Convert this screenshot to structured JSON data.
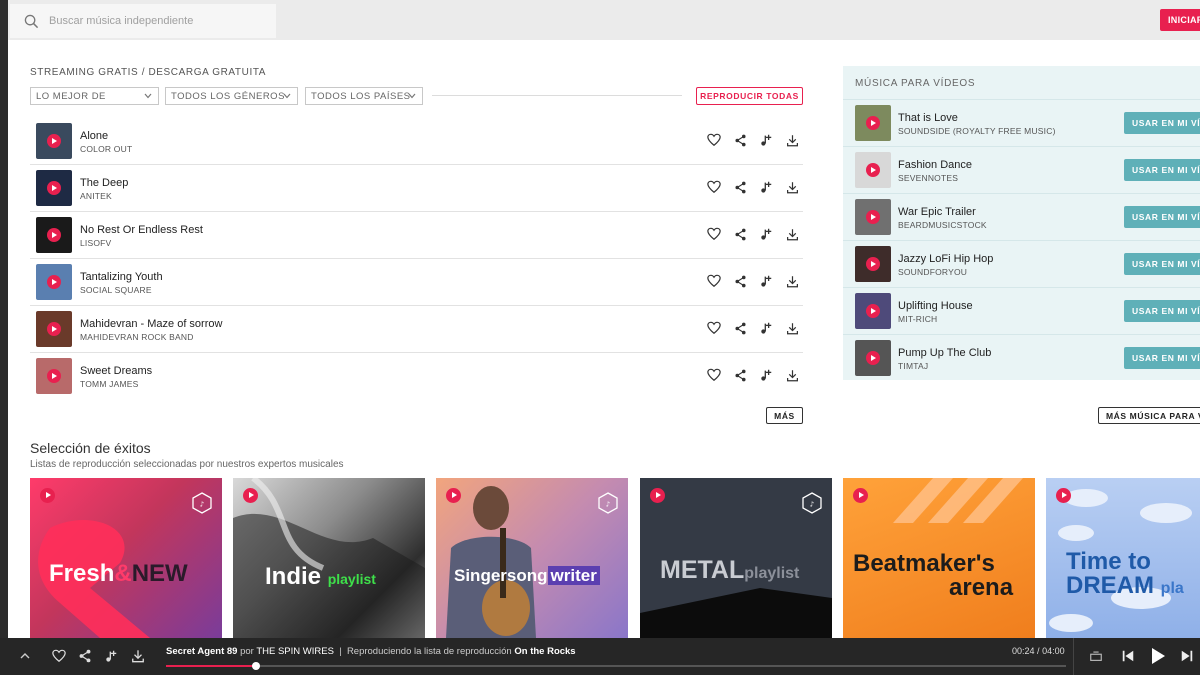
{
  "search": {
    "placeholder": "Buscar música independiente"
  },
  "header": {
    "login_label": "INICIAR"
  },
  "streaming": {
    "title": "STREAMING GRATIS / DESCARGA GRATUITA",
    "filters": [
      {
        "label": "LO MEJOR DE"
      },
      {
        "label": "TODOS LOS GÉNEROS"
      },
      {
        "label": "TODOS LOS PAÍSES"
      }
    ],
    "play_all_label": "REPRODUCIR TODAS",
    "more_label": "MÁS",
    "tracks": [
      {
        "title": "Alone",
        "artist": "COLOR OUT",
        "color": "#3a4a5e"
      },
      {
        "title": "The Deep",
        "artist": "ANITEK",
        "color": "#1e2a44"
      },
      {
        "title": "No Rest Or Endless Rest",
        "artist": "LISOFV",
        "color": "#1a1a1a"
      },
      {
        "title": "Tantalizing Youth",
        "artist": "SOCIAL SQUARE",
        "color": "#5a7fb0"
      },
      {
        "title": "Mahidevran - Maze of sorrow",
        "artist": "MAHIDEVRAN ROCK BAND",
        "color": "#6a3a2a"
      },
      {
        "title": "Sweet Dreams",
        "artist": "TOMM JAMES",
        "color": "#b86a6a"
      }
    ]
  },
  "music_for_videos": {
    "title": "MÚSICA PARA VÍDEOS",
    "use_label": "USAR EN MI VÍDEO",
    "more_label": "MÁS MÚSICA PARA VÍDEOS",
    "items": [
      {
        "title": "That is Love",
        "artist": "SOUNDSIDE (ROYALTY FREE MUSIC)",
        "color": "#7d8a5e"
      },
      {
        "title": "Fashion Dance",
        "artist": "SEVENNOTES",
        "color": "#d8d8d8"
      },
      {
        "title": "War Epic Trailer",
        "artist": "BEARDMUSICSTOCK",
        "color": "#707070"
      },
      {
        "title": "Jazzy LoFi Hip Hop",
        "artist": "SOUNDFORYOU",
        "color": "#3e2c2a"
      },
      {
        "title": "Uplifting House",
        "artist": "MIT-RICH",
        "color": "#4e4a7a"
      },
      {
        "title": "Pump Up The Club",
        "artist": "TIMTAJ",
        "color": "#555555"
      }
    ]
  },
  "hits": {
    "title": "Selección de éxitos",
    "subtitle": "Listas de reproducción seleccionadas por nuestros expertos musicales",
    "cards": [
      {
        "main": "Fresh",
        "amp": "&",
        "accent": "NEW"
      },
      {
        "main": "Indie",
        "accent": "playlist"
      },
      {
        "main": "Singersong",
        "accent": "writer"
      },
      {
        "main": "METAL",
        "accent": "playlist"
      },
      {
        "main": "Beatmaker's",
        "accent": "arena"
      },
      {
        "main": "Time to",
        "accent": "DREAM",
        "extra": "pla"
      }
    ]
  },
  "player": {
    "song": "Secret Agent 89",
    "by": "por",
    "artist": "THE SPIN WIRES",
    "separator": "|",
    "playing_text": "Reproduciendo la lista de reproducción",
    "playlist": "On the Rocks",
    "elapsed": "00:24",
    "time_separator": "/",
    "total": "04:00",
    "progress": 0.1
  },
  "colors": {
    "accent": "#e8204f",
    "teal": "#5fb0b8",
    "player_bg": "#262626"
  }
}
